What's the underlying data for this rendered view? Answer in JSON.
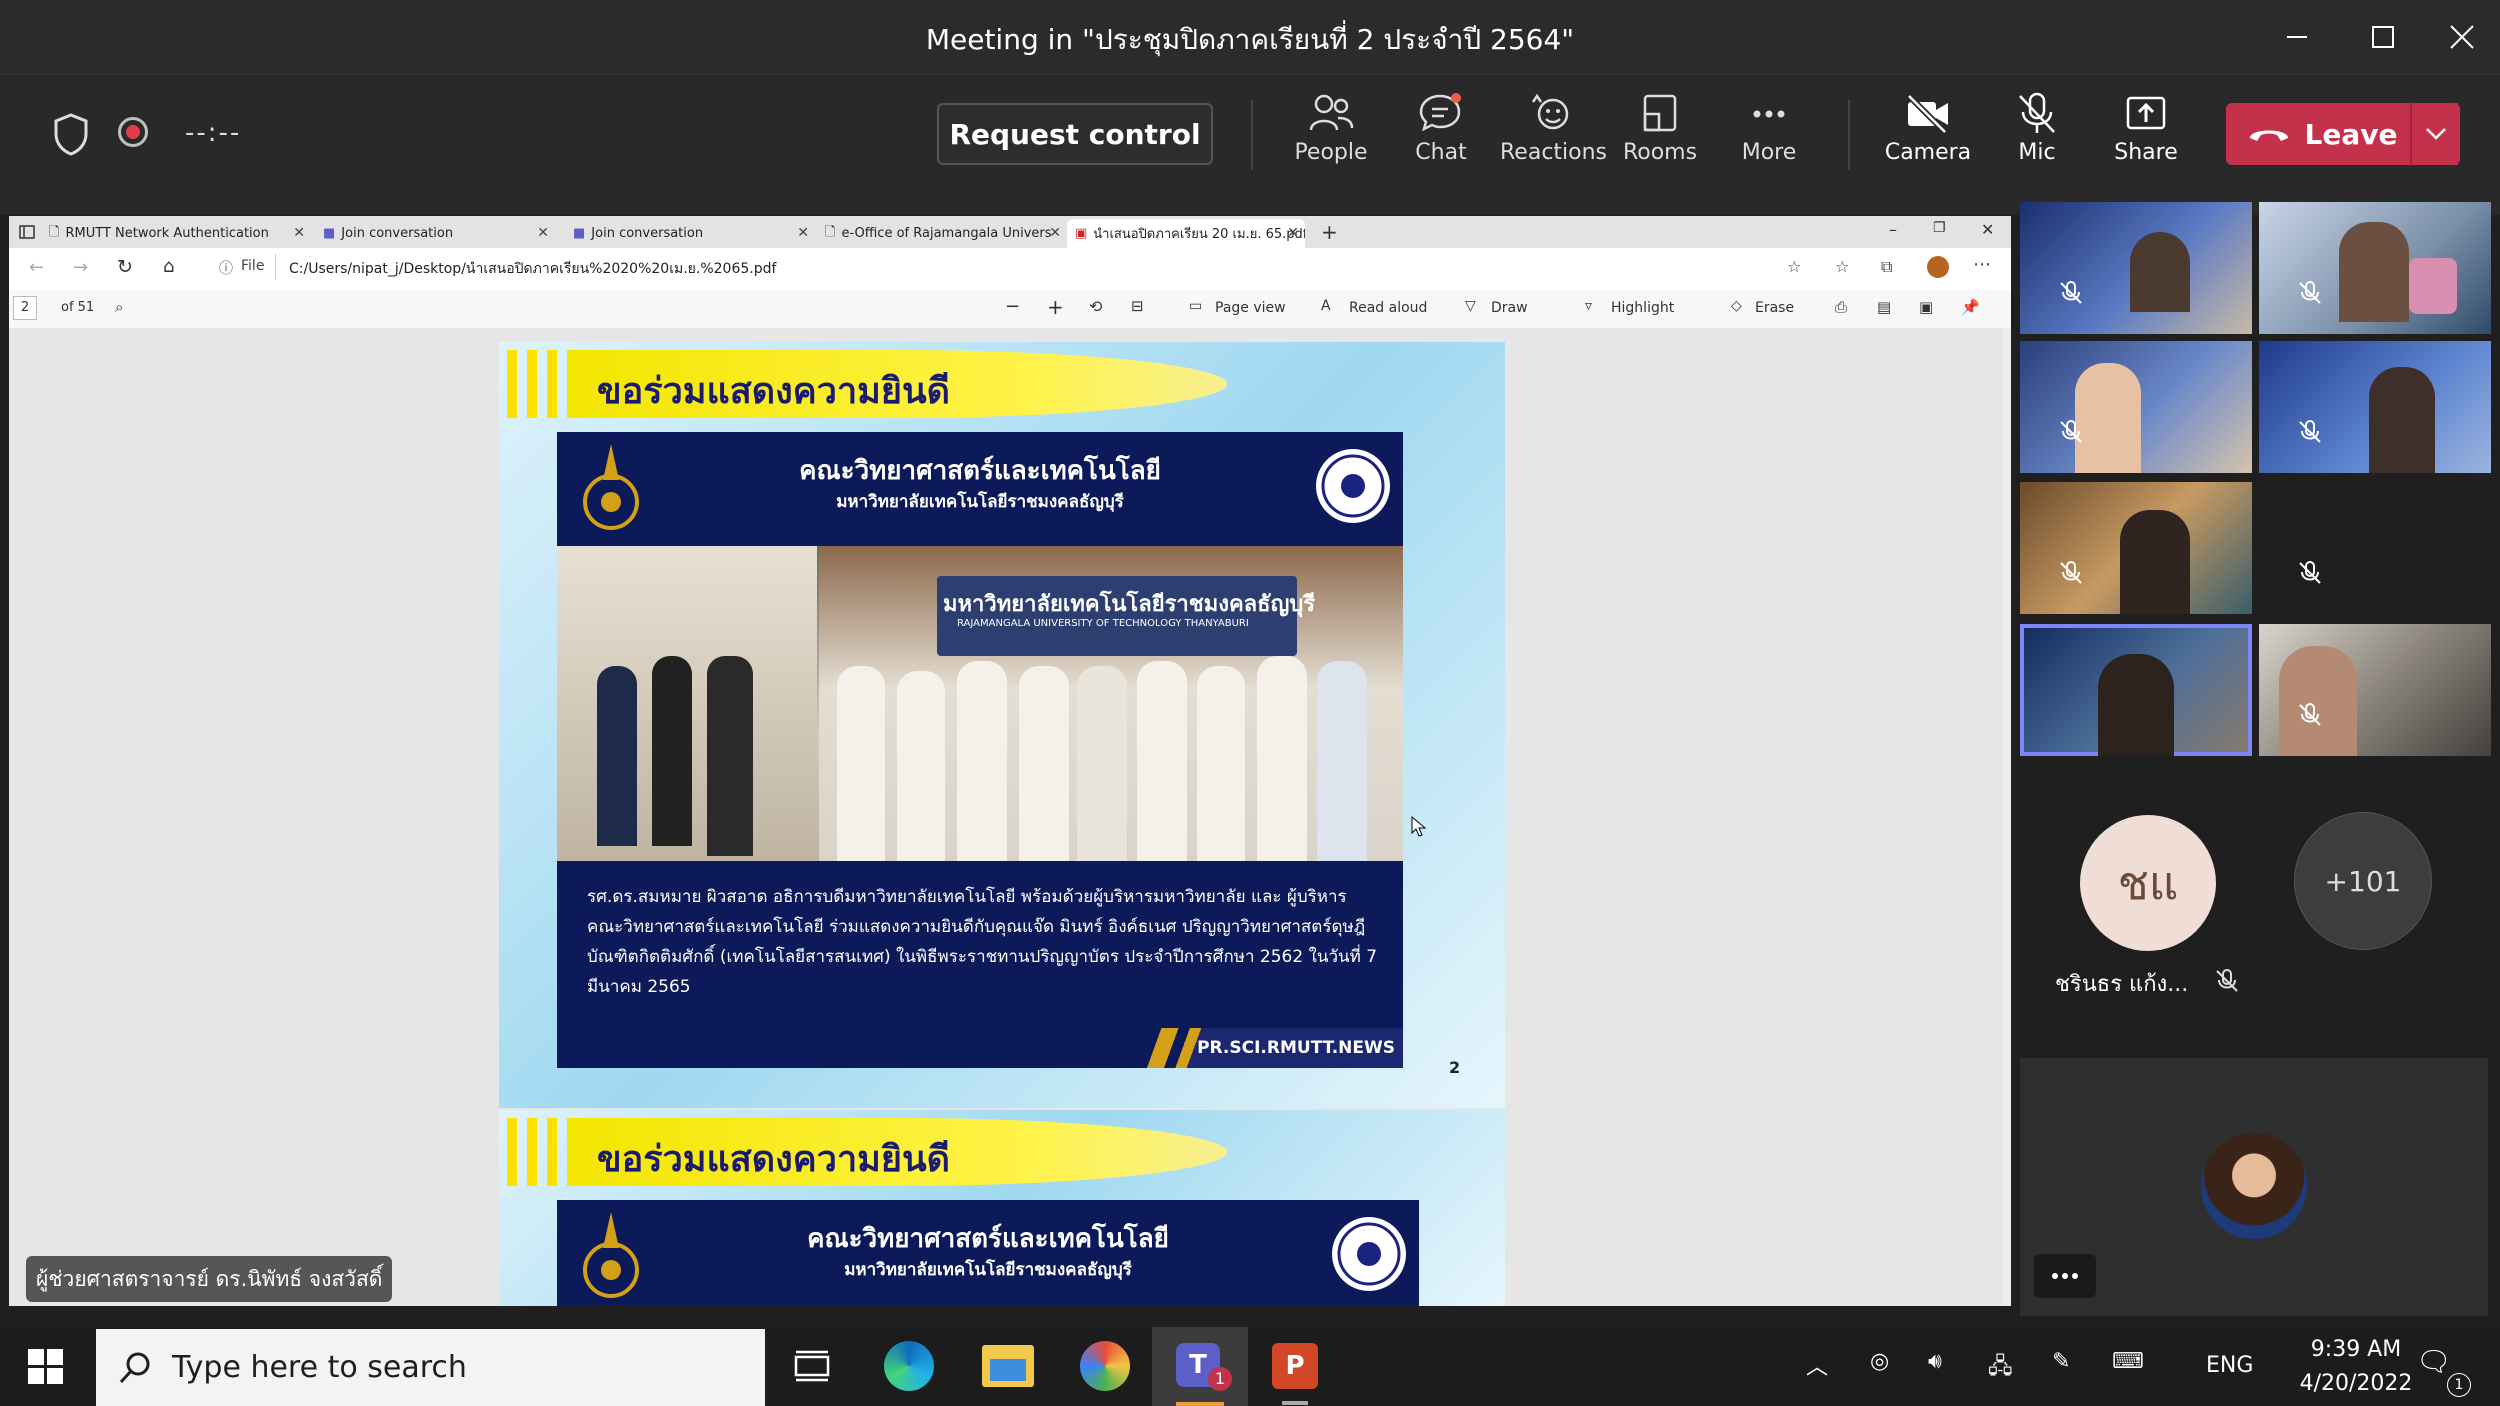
{
  "window": {
    "title": "Meeting in \"ประชุมปิดภาคเรียนที่ 2 ประจำปี 2564\""
  },
  "toolbar": {
    "timer": "--:--",
    "request_control": "Request control",
    "buttons": [
      {
        "label": "People",
        "icon": "people-icon"
      },
      {
        "label": "Chat",
        "icon": "chat-icon"
      },
      {
        "label": "Reactions",
        "icon": "reactions-icon"
      },
      {
        "label": "Rooms",
        "icon": "rooms-icon"
      },
      {
        "label": "More",
        "icon": "more-icon"
      },
      {
        "label": "Camera",
        "icon": "camera-off-icon"
      },
      {
        "label": "Mic",
        "icon": "mic-off-icon"
      },
      {
        "label": "Share",
        "icon": "share-icon"
      }
    ],
    "leave": "Leave"
  },
  "browser": {
    "tabs": [
      {
        "label": "RMUTT Network Authentication"
      },
      {
        "label": "Join conversation"
      },
      {
        "label": "Join conversation"
      },
      {
        "label": "e-Office of Rajamangala Univers"
      },
      {
        "label": "นำเสนอปิดภาคเรียน 20 เม.ย. 65.pdf"
      }
    ],
    "file_label": "File",
    "url": "C:/Users/nipat_j/Desktop/นำเสนอปิดภาคเรียน%2020%20เม.ย.%2065.pdf"
  },
  "pdf_toolbar": {
    "page": "2",
    "page_count": "of 51",
    "page_view": "Page view",
    "read_aloud": "Read aloud",
    "draw": "Draw",
    "highlight": "Highlight",
    "erase": "Erase"
  },
  "slides": [
    {
      "banner": "ขอร่วมแสดงความยินดี",
      "faculty": "คณะวิทยาศาสตร์และเทคโนโลยี",
      "university": "มหาวิทยาลัยเทคโนโลยีราชมงคลธัญบุรี",
      "caption": "รศ.ดร.สมหมาย ผิวสอาด อธิการบดีมหาวิทยาลัยเทคโนโลยี พร้อมด้วยผู้บริหารมหาวิทยาลัย และ ผู้บริหาร คณะวิทยาศาสตร์และเทคโนโลยี ร่วมแสดงความยินดีกับคุณแจ๊ด มินทร์ อิงค์ธเนศ ปริญญาวิทยาศาสตร์ดุษฎีบัณฑิตกิตติมศักดิ์ (เทคโนโลยีสารสนเทศ) ในพิธีพระราชทานปริญญาบัตร ประจำปีการศึกษา 2562 ในวันที่ 7 มีนาคม 2565",
      "banner_in_photo": "มหาวิทยาลัยเทคโนโลยีราชมงคลธัญบุรี",
      "banner_in_photo_en": "RAJAMANGALA UNIVERSITY OF TECHNOLOGY THANYABURI",
      "credit": "PR.SCI.RMUTT.NEWS",
      "page_number": "2"
    },
    {
      "banner": "ขอร่วมแสดงความยินดี",
      "faculty": "คณะวิทยาศาสตร์และเทคโนโลยี",
      "university": "มหาวิทยาลัยเทคโนโลยีราชมงคลธัญบุรี"
    }
  ],
  "presenter": {
    "name": "ผู้ช่วยศาสตราจารย์ ดร.นิพัทธ์ จงสวัสดิ์"
  },
  "participants": {
    "avatar_initials": "ชแ",
    "avatar_name": "ชรินธร แก้ง...",
    "overflow": "+101"
  },
  "taskbar": {
    "search_placeholder": "Type here to search",
    "language": "ENG",
    "time": "9:39 AM",
    "date": "4/20/2022",
    "notification_count": "1"
  },
  "colors": {
    "leave": "#c4314b",
    "record": "#e23c4b",
    "active_speaker": "#7f85f5",
    "slide_navy": "#0d1a5a",
    "banner_yellow": "#f3e600"
  }
}
